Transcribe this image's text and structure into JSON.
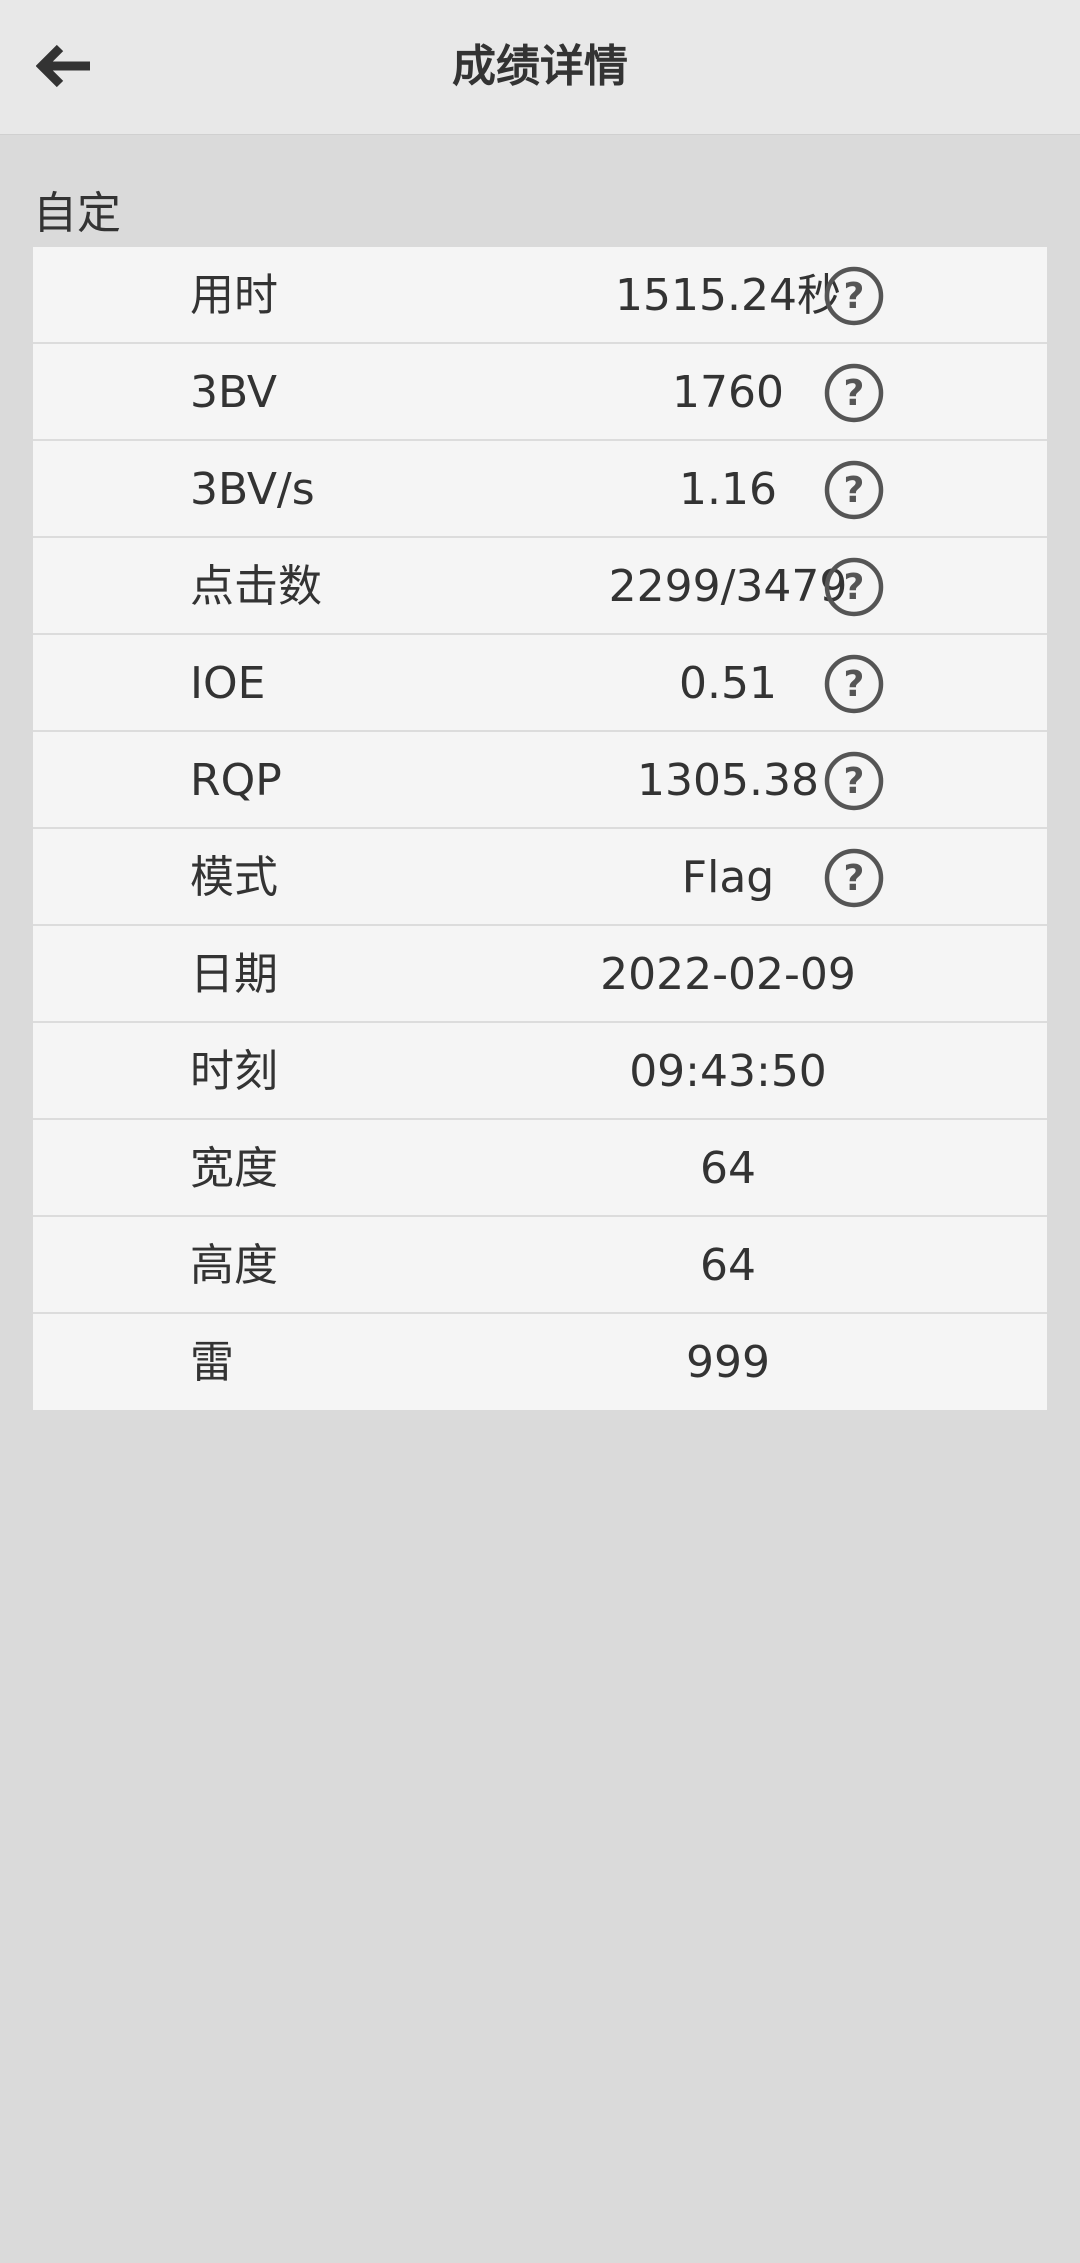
{
  "header": {
    "back_icon": "arrow-left-icon",
    "title": "成绩详情"
  },
  "section": {
    "label": "自定"
  },
  "rows": [
    {
      "label": "用时",
      "value": "1515.24秒",
      "help": true
    },
    {
      "label": "3BV",
      "value": "1760",
      "help": true
    },
    {
      "label": "3BV/s",
      "value": "1.16",
      "help": true
    },
    {
      "label": "点击数",
      "value": "2299/3479",
      "help": true
    },
    {
      "label": "IOE",
      "value": "0.51",
      "help": true
    },
    {
      "label": "RQP",
      "value": "1305.38",
      "help": true
    },
    {
      "label": "模式",
      "value": "Flag",
      "help": true
    },
    {
      "label": "日期",
      "value": "2022-02-09",
      "help": false
    },
    {
      "label": "时刻",
      "value": "09:43:50",
      "help": false
    },
    {
      "label": "宽度",
      "value": "64",
      "help": false
    },
    {
      "label": "高度",
      "value": "64",
      "help": false
    },
    {
      "label": "雷",
      "value": "999",
      "help": false
    }
  ],
  "colors": {
    "background": "#dadada",
    "header": "#e8e8e8",
    "row": "#f5f5f5",
    "text": "#333333",
    "icon": "#555555"
  }
}
